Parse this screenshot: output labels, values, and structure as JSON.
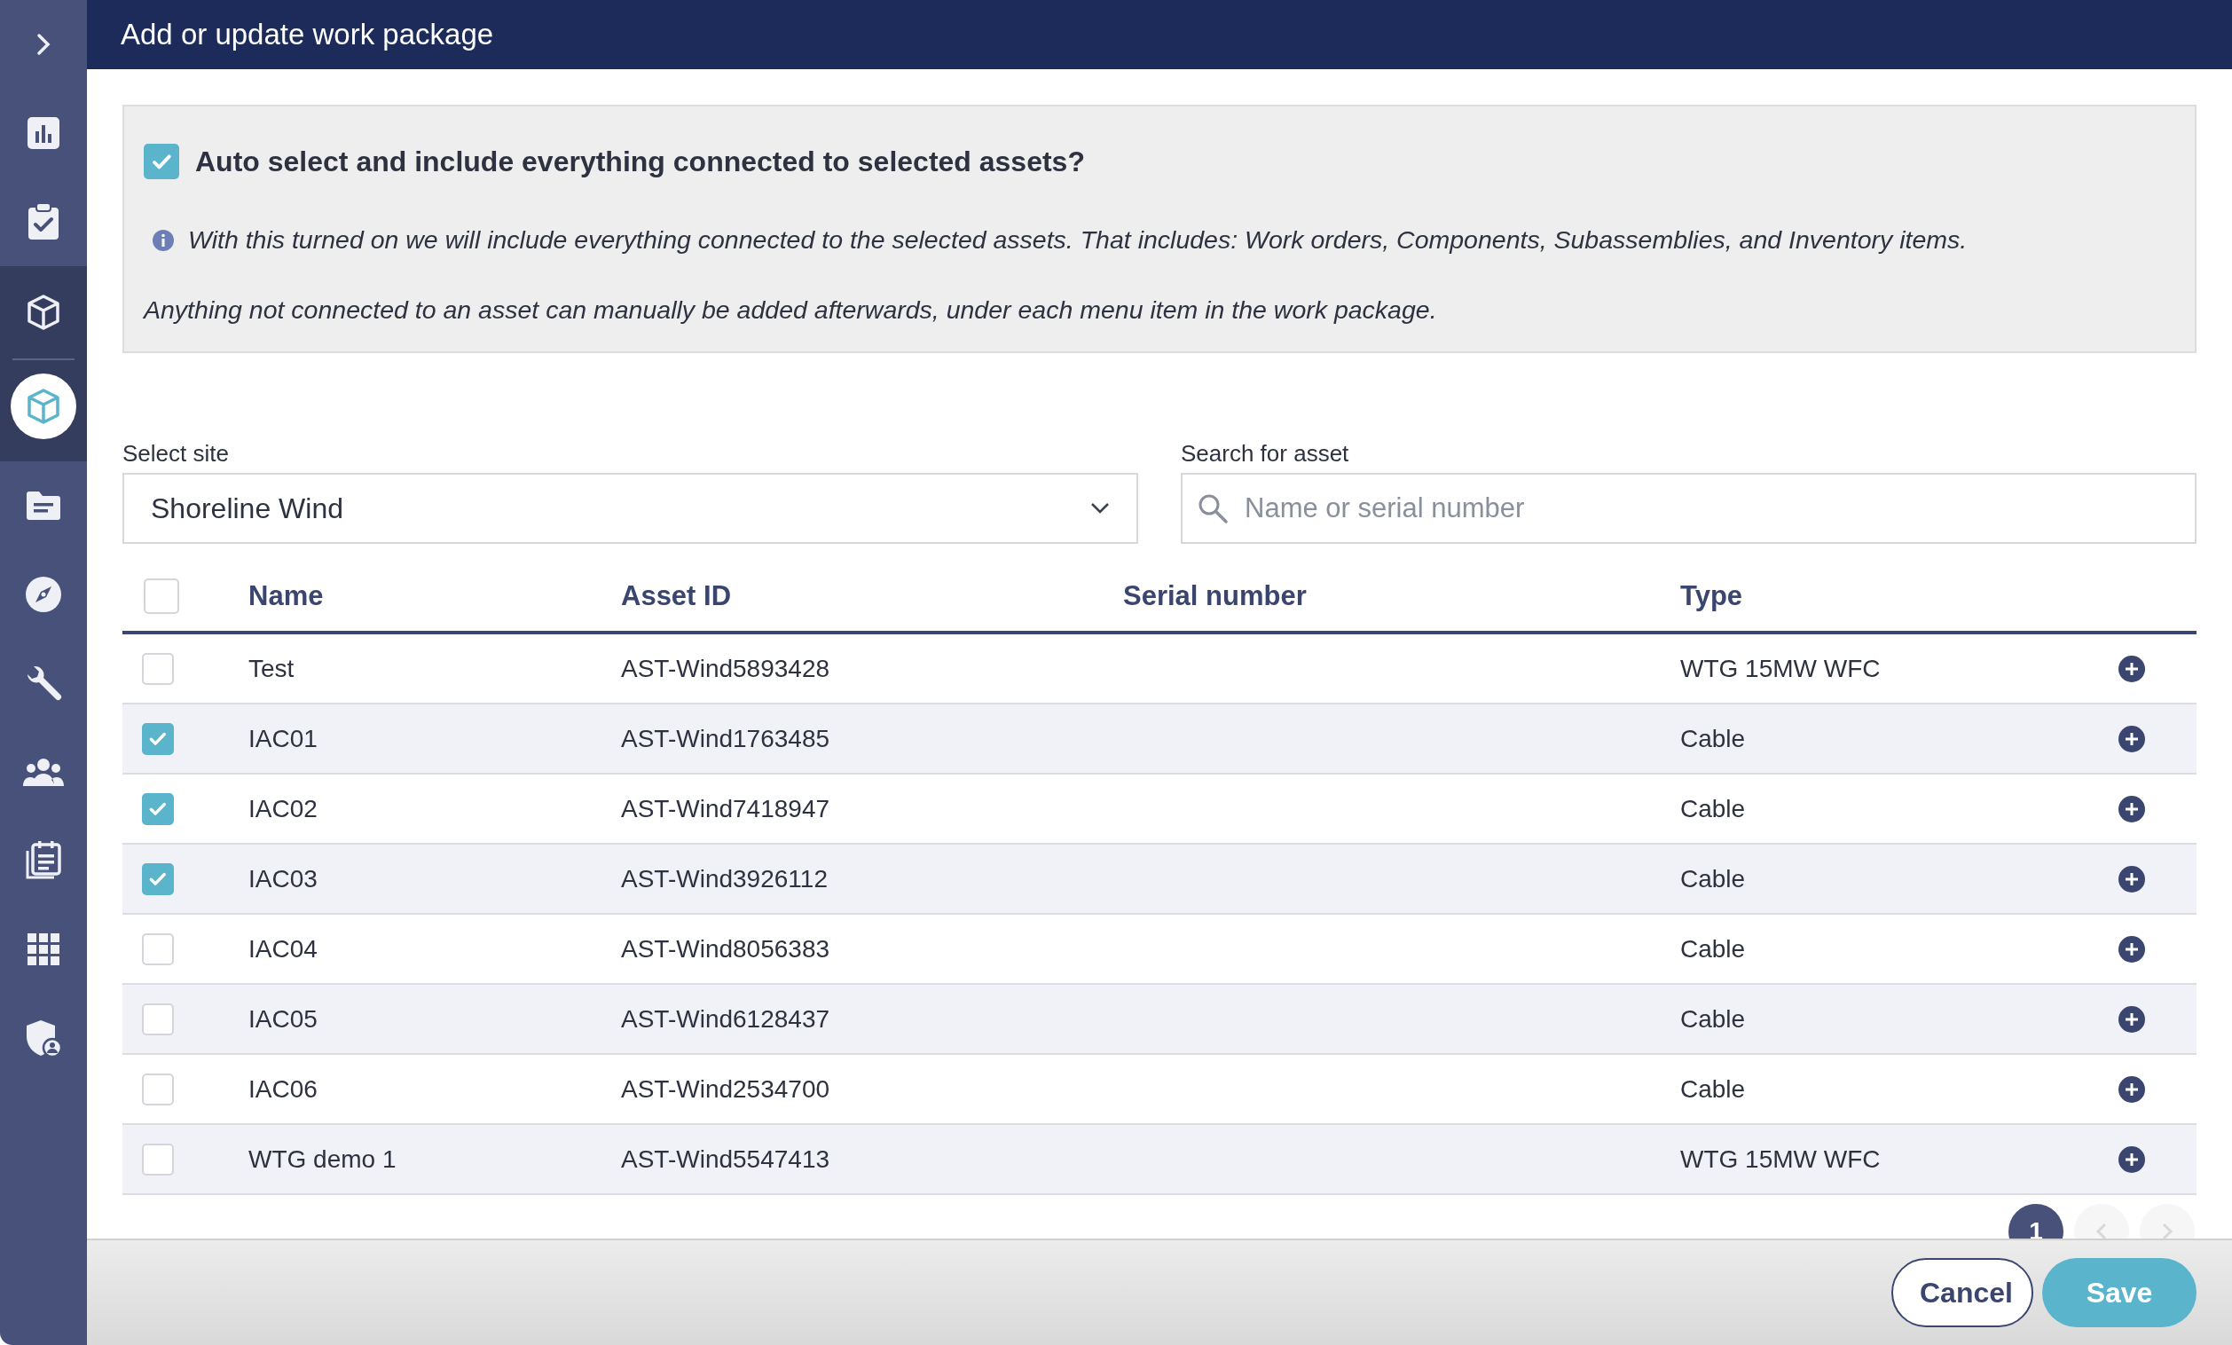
{
  "sidebar": {
    "items": [
      {
        "selected": false
      },
      {
        "selected": false
      },
      {
        "selected": false
      },
      {
        "selected": false,
        "expanded": true,
        "children": [
          {
            "selected": true
          }
        ]
      },
      {
        "selected": false
      },
      {
        "selected": false
      },
      {
        "selected": false
      },
      {
        "selected": false
      },
      {
        "selected": false
      },
      {
        "selected": false
      },
      {
        "selected": false
      }
    ]
  },
  "window": {
    "title": "Add or update work package"
  },
  "auto_select": {
    "checked": true,
    "label": "Auto select and include everything connected to selected assets?",
    "info": "With this turned on we will include everything connected to the selected assets. That includes: Work orders, Components, Subassemblies, and Inventory items.",
    "note": "Anything not connected to an asset can manually be added afterwards, under each menu item in the work package."
  },
  "site": {
    "label": "Select site",
    "value": "Shoreline Wind"
  },
  "search": {
    "label": "Search for asset",
    "placeholder": "Name or serial number"
  },
  "table": {
    "select_all": {
      "checked": false
    },
    "columns": [
      "Name",
      "Asset ID",
      "Serial number",
      "Type"
    ],
    "rows": [
      {
        "checked": false,
        "name": "Test",
        "asset_id": "AST-Wind5893428",
        "type": "WTG 15MW WFC"
      },
      {
        "checked": true,
        "name": "IAC01",
        "asset_id": "AST-Wind1763485",
        "type": "Cable"
      },
      {
        "checked": true,
        "name": "IAC02",
        "asset_id": "AST-Wind7418947",
        "type": "Cable"
      },
      {
        "checked": true,
        "name": "IAC03",
        "asset_id": "AST-Wind3926112",
        "type": "Cable"
      },
      {
        "checked": false,
        "name": "IAC04",
        "asset_id": "AST-Wind8056383",
        "type": "Cable"
      },
      {
        "checked": false,
        "name": "IAC05",
        "asset_id": "AST-Wind6128437",
        "type": "Cable"
      },
      {
        "checked": false,
        "name": "IAC06",
        "asset_id": "AST-Wind2534700",
        "type": "Cable"
      },
      {
        "checked": false,
        "name": "WTG demo 1",
        "asset_id": "AST-Wind5547413",
        "type": "WTG 15MW WFC"
      }
    ]
  },
  "pagination": {
    "pages": [
      {
        "label": "1",
        "selected": true
      }
    ],
    "previous_disabled": true,
    "next_disabled": true
  },
  "buttons": [
    {
      "kind": "secondary",
      "label": "Cancel"
    },
    {
      "kind": "primary",
      "label": "Save"
    }
  ]
}
